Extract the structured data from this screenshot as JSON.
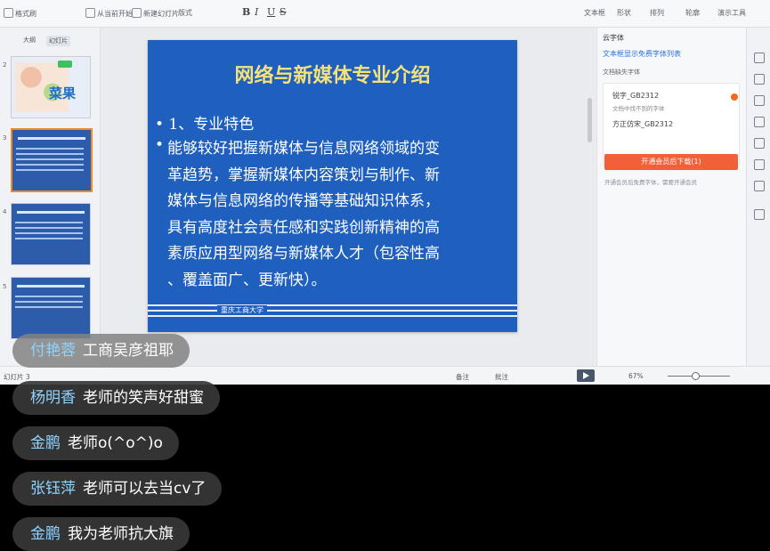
{
  "ribbon": {
    "buttons": [
      "格式刷",
      "从当前开始",
      "新建幻灯片",
      "版式",
      "节",
      "文本框",
      "形状",
      "排列",
      "轮廓",
      "演示工具"
    ],
    "format_buttons": [
      "B",
      "I",
      "U",
      "S"
    ]
  },
  "thumbs": {
    "tabs": [
      "大纲",
      "幻灯片"
    ],
    "numbers": [
      "2",
      "3",
      "4",
      "5"
    ],
    "slide2_label": "菜果"
  },
  "slide": {
    "title": "网络与新媒体专业介绍",
    "bullet1": "• 1、专业特色",
    "bullet2_lines": [
      "能够较好把握新媒体与信息网络领域的变",
      "革趋势，掌握新媒体内容策划与制作、新",
      "媒体与信息网络的传播等基础知识体系，",
      "具有高度社会责任感和实践创新精神的高",
      "素质应用型网络与新媒体人才（包容性高",
      "、覆盖面广、更新快）。"
    ],
    "school": "重庆工商大学"
  },
  "right_panel": {
    "title": "云字体",
    "link": "文本框显示免费字体列表",
    "subtitle": "文档缺失字体",
    "item1": "锐字_GB2312",
    "item1_note": "文档中找不到的字体",
    "item2": "方正仿宋_GB2312",
    "button": "开通会员后下载(1)",
    "note": "开通会员后免费字体，需要开通会员"
  },
  "status": {
    "left": "幻灯片 3",
    "notes": "备注",
    "comments": "批注",
    "zoom": "67%"
  },
  "chat": [
    {
      "name": "付艳蓉",
      "msg": "工商吴彦祖耶"
    },
    {
      "name": "杨明香",
      "msg": "老师的笑声好甜蜜"
    },
    {
      "name": "金鹏",
      "msg": "老师o(^o^)o"
    },
    {
      "name": "张钰萍",
      "msg": "老师可以去当cv了"
    },
    {
      "name": "金鹏",
      "msg": "我为老师抗大旗"
    }
  ]
}
